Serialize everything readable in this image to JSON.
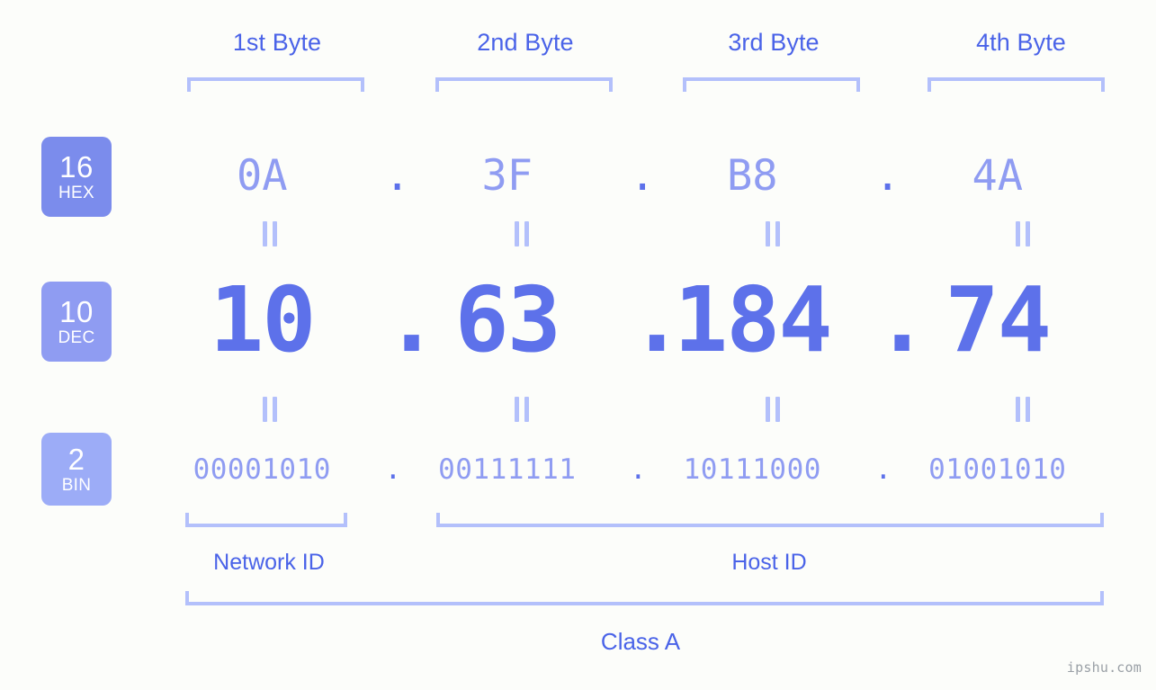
{
  "background_color": "#fcfdfa",
  "accent_color": "#4a63e8",
  "value_color": "#5d71ea",
  "muted_color": "#8f9cf2",
  "bracket_color": "#b3c0fb",
  "header": {
    "byte_labels": [
      {
        "label": "1st Byte"
      },
      {
        "label": "2nd Byte"
      },
      {
        "label": "3rd Byte"
      },
      {
        "label": "4th Byte"
      }
    ]
  },
  "radix_badges": [
    {
      "number": "16",
      "name": "HEX",
      "color": "#7b8cec"
    },
    {
      "number": "10",
      "name": "DEC",
      "color": "#8f9cf2"
    },
    {
      "number": "2",
      "name": "BIN",
      "color": "#9cacf7"
    }
  ],
  "rows": {
    "hex": {
      "radix": "16",
      "radix_name": "HEX",
      "octets": [
        "0A",
        "3F",
        "B8",
        "4A"
      ],
      "separator": "."
    },
    "dec": {
      "radix": "10",
      "radix_name": "DEC",
      "octets": [
        "10",
        "63",
        "184",
        "74"
      ],
      "separator": "."
    },
    "bin": {
      "radix": "2",
      "radix_name": "BIN",
      "octets": [
        "00001010",
        "00111111",
        "10111000",
        "01001010"
      ],
      "separator": "."
    }
  },
  "equals_marks": {
    "glyph": "=",
    "count_per_gap": 4
  },
  "sections": {
    "network_id": "Network ID",
    "host_id": "Host ID",
    "class": "Class A"
  },
  "watermark": "ipshu.com"
}
